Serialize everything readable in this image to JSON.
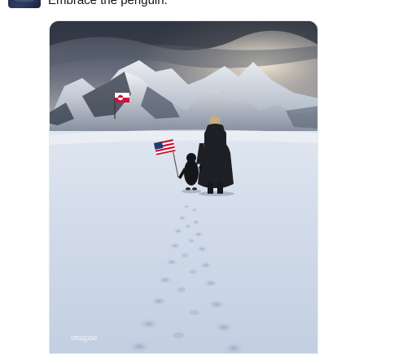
{
  "post": {
    "text": "Embrace the penguin."
  },
  "media": {
    "alt": "Photo of a man in a dark coat walking hand in hand with a penguin across a snowfield toward mountains; the penguin carries a US flag and a Greenland flag is planted in the distance",
    "watermark": "ımagıne"
  },
  "icons": {
    "avatar": "avatar-image"
  },
  "colors": {
    "text": "#0f1419",
    "media_border": "#e4e8eb"
  }
}
